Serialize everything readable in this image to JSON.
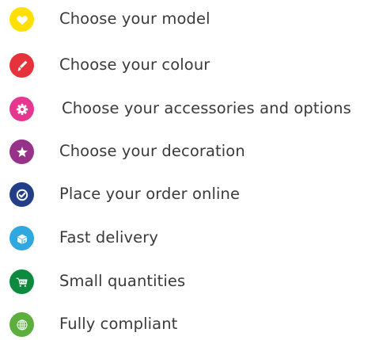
{
  "steps": [
    {
      "label": "Choose your model",
      "icon": "heart-icon",
      "color": "#FFE000"
    },
    {
      "label": "Choose your colour",
      "icon": "paintbrush-icon",
      "color": "#E6333B"
    },
    {
      "label": "Choose your accessories and options",
      "icon": "gear-icon",
      "color": "#E5378F"
    },
    {
      "label": "Choose your decoration",
      "icon": "star-icon",
      "color": "#963288"
    },
    {
      "label": "Place your order online",
      "icon": "check-circle-icon",
      "color": "#223E86"
    },
    {
      "label": "Fast delivery",
      "icon": "delivery-box-icon",
      "color": "#2EA8DF"
    },
    {
      "label": "Small quantities",
      "icon": "shopping-cart-pcs-icon",
      "color": "#0D8A3E"
    },
    {
      "label": "Fully compliant",
      "icon": "globe-icon",
      "color": "#5CAE3D"
    }
  ],
  "cart_icon_text": "PCS"
}
